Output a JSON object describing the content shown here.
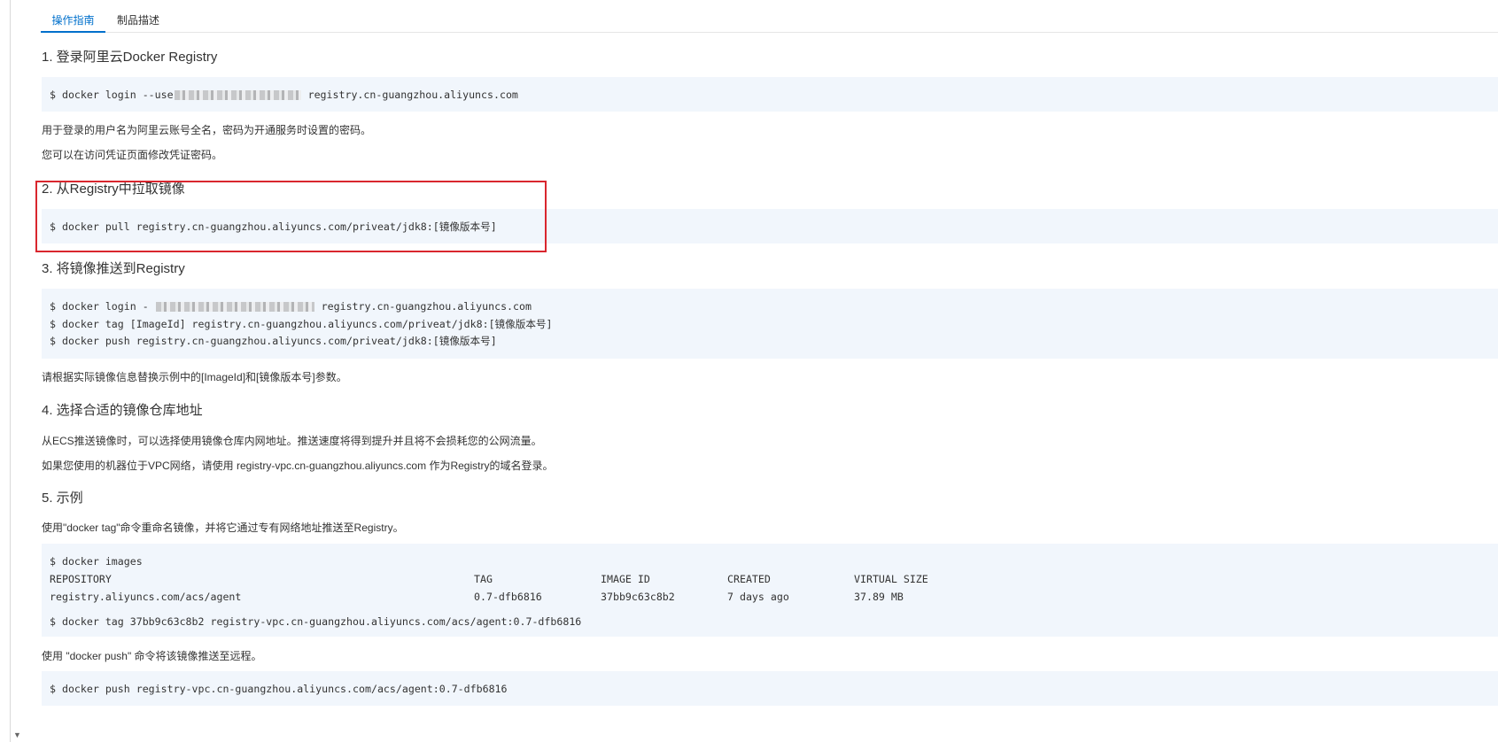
{
  "tabs": [
    {
      "label": "操作指南",
      "active": true
    },
    {
      "label": "制品描述",
      "active": false
    }
  ],
  "colors": {
    "accent": "#0070cc",
    "code_bg": "#f1f6fc",
    "highlight_border": "#d9262e"
  },
  "sections": {
    "s1": {
      "title": "1. 登录阿里云Docker Registry",
      "code": {
        "prefix": "$ docker login --use",
        "suffix": " registry.cn-guangzhou.aliyuncs.com"
      },
      "notes": [
        "用于登录的用户名为阿里云账号全名，密码为开通服务时设置的密码。",
        "您可以在访问凭证页面修改凭证密码。"
      ]
    },
    "s2": {
      "title": "2. 从Registry中拉取镜像",
      "code": "$ docker pull registry.cn-guangzhou.aliyuncs.com/priveat/jdk8:[镜像版本号]"
    },
    "s3": {
      "title": "3. 将镜像推送到Registry",
      "code_login": {
        "prefix": "$ docker login - ",
        "suffix": " registry.cn-guangzhou.aliyuncs.com"
      },
      "code_tag": "$ docker tag [ImageId] registry.cn-guangzhou.aliyuncs.com/priveat/jdk8:[镜像版本号]",
      "code_push": "$ docker push registry.cn-guangzhou.aliyuncs.com/priveat/jdk8:[镜像版本号]",
      "note": "请根据实际镜像信息替换示例中的[ImageId]和[镜像版本号]参数。"
    },
    "s4": {
      "title": "4. 选择合适的镜像仓库地址",
      "notes": [
        "从ECS推送镜像时，可以选择使用镜像仓库内网地址。推送速度将得到提升并且将不会损耗您的公网流量。",
        "如果您使用的机器位于VPC网络，请使用 registry-vpc.cn-guangzhou.aliyuncs.com 作为Registry的域名登录。"
      ]
    },
    "s5": {
      "title": "5. 示例",
      "note1": "使用\"docker tag\"命令重命名镜像，并将它通过专有网络地址推送至Registry。",
      "cmd_images": "$ docker images",
      "table": {
        "headers": [
          "REPOSITORY",
          "TAG",
          "IMAGE ID",
          "CREATED",
          "VIRTUAL SIZE"
        ],
        "row": [
          "registry.aliyuncs.com/acs/agent",
          "0.7-dfb6816",
          "37bb9c63c8b2",
          "7 days ago",
          "37.89 MB"
        ]
      },
      "cmd_tag": "$ docker tag 37bb9c63c8b2 registry-vpc.cn-guangzhou.aliyuncs.com/acs/agent:0.7-dfb6816",
      "note2": "使用 \"docker push\" 命令将该镜像推送至远程。",
      "cmd_push": "$ docker push registry-vpc.cn-guangzhou.aliyuncs.com/acs/agent:0.7-dfb6816"
    }
  }
}
